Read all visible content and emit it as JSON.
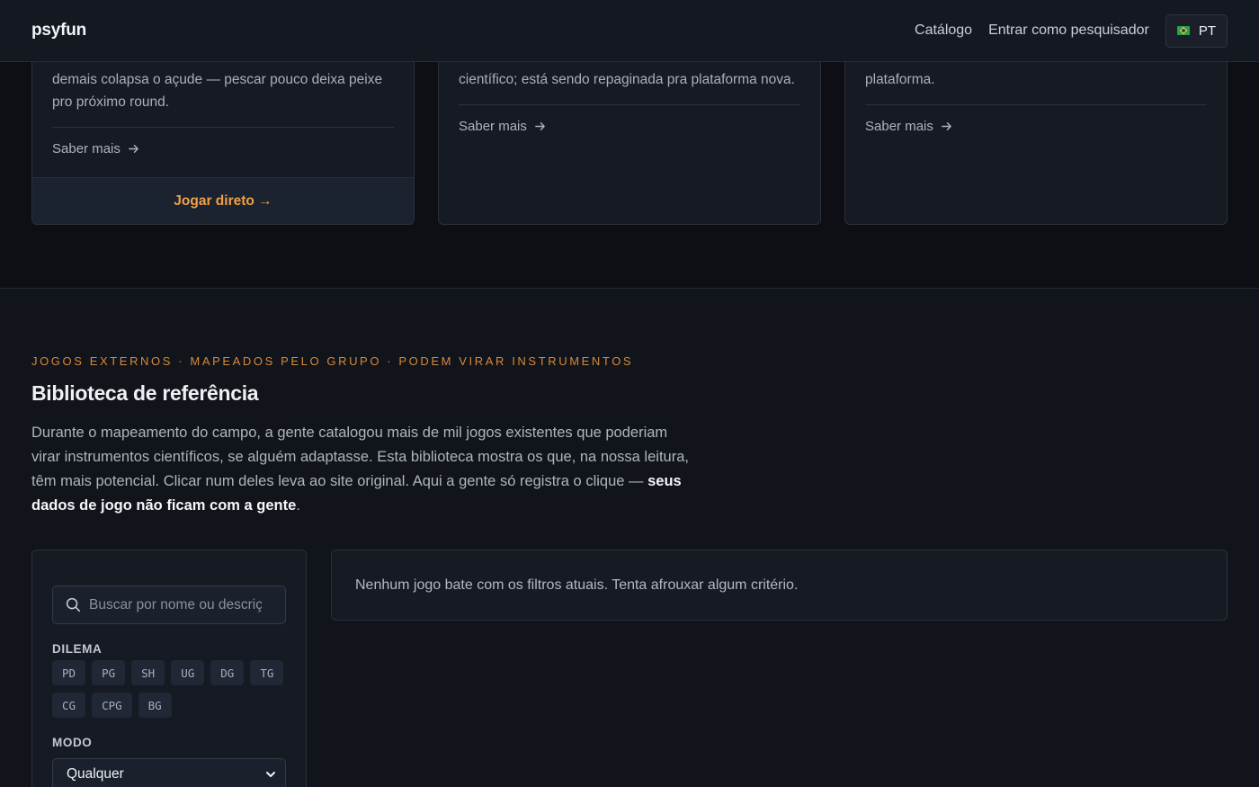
{
  "header": {
    "brand": "psyfun",
    "nav": {
      "catalog": "Catálogo",
      "researcher_login": "Entrar como pesquisador",
      "lang": "PT"
    }
  },
  "cards": [
    {
      "desc": "demais colapsa o açude — pescar pouco deixa peixe pro próximo round.",
      "more": "Saber mais",
      "play": "Jogar direto →"
    },
    {
      "desc": "científico; está sendo repaginada pra plataforma nova.",
      "more": "Saber mais"
    },
    {
      "desc": "plataforma.",
      "more": "Saber mais"
    }
  ],
  "library": {
    "eyebrow": "JOGOS EXTERNOS · MAPEADOS PELO GRUPO · PODEM VIRAR INSTRUMENTOS",
    "title": "Biblioteca de referência",
    "intro": "Durante o mapeamento do campo, a gente catalogou mais de mil jogos existentes que poderiam virar instrumentos científicos, se alguém adaptasse. Esta biblioteca mostra os que, na nossa leitura, têm mais potencial. Clicar num deles leva ao site original. Aqui a gente só registra o clique — ",
    "intro_bold": "seus dados de jogo não ficam com a gente",
    "intro_end": ".",
    "filters": {
      "search_placeholder": "Buscar por nome ou descrição",
      "dilemma_label": "DILEMA",
      "dilemmas": [
        "PD",
        "PG",
        "SH",
        "UG",
        "DG",
        "TG",
        "CG",
        "CPG",
        "BG"
      ],
      "mode_label": "MODO",
      "mode_value": "Qualquer"
    },
    "empty_message": "Nenhum jogo bate com os filtros atuais. Tenta afrouxar algum critério."
  },
  "colors": {
    "accent": "#f0a045",
    "eyebrow": "#d8883a",
    "background": "#0d0f15",
    "card": "#151a23"
  }
}
